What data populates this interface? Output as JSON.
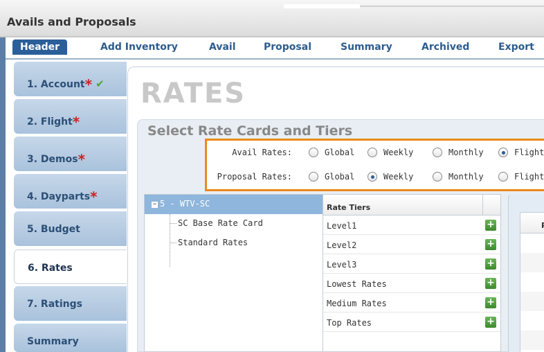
{
  "app": {
    "title": "Avails and Proposals"
  },
  "nav": {
    "items": [
      {
        "label": "Header",
        "active": true
      },
      {
        "label": "Add Inventory",
        "active": false
      },
      {
        "label": "Avail",
        "active": false
      },
      {
        "label": "Proposal",
        "active": false
      },
      {
        "label": "Summary",
        "active": false
      },
      {
        "label": "Archived",
        "active": false
      },
      {
        "label": "Export",
        "active": false
      }
    ]
  },
  "steps": [
    {
      "label": "1. Account",
      "required": true,
      "complete": true
    },
    {
      "label": "2. Flight",
      "required": true,
      "complete": false
    },
    {
      "label": "3. Demos",
      "required": true,
      "complete": false
    },
    {
      "label": "4. Dayparts",
      "required": true,
      "complete": false
    },
    {
      "label": "5. Budget",
      "required": false,
      "complete": false
    },
    {
      "label": "6. Rates",
      "required": false,
      "complete": false,
      "active": true
    },
    {
      "label": "7. Ratings",
      "required": false,
      "complete": false
    },
    {
      "label": "Summary",
      "required": false,
      "complete": false
    }
  ],
  "page": {
    "title": "RATES",
    "section_title": "Select Rate Cards and Tiers"
  },
  "rate_options": {
    "avail": {
      "label": "Avail Rates:",
      "options": [
        "Global",
        "Weekly",
        "Monthly",
        "Flight"
      ],
      "selected": "Flight"
    },
    "proposal": {
      "label": "Proposal Rates:",
      "options": [
        "Global",
        "Weekly",
        "Monthly",
        "Flight"
      ],
      "selected": "Weekly"
    }
  },
  "tree": {
    "root": "5 - WTV-SC",
    "children": [
      "SC Base Rate Card",
      "Standard Rates"
    ]
  },
  "tiers": {
    "header": "Rate Tiers",
    "rows": [
      "Level1",
      "Level2",
      "Level3",
      "Lowest Rates",
      "Medium Rates",
      "Top Rates"
    ]
  },
  "grid": {
    "header": "P"
  },
  "colors": {
    "accent": "#2a5f99",
    "highlight_border": "#e98a1a",
    "required_star": "#cc2222",
    "check": "#4fa43a"
  }
}
